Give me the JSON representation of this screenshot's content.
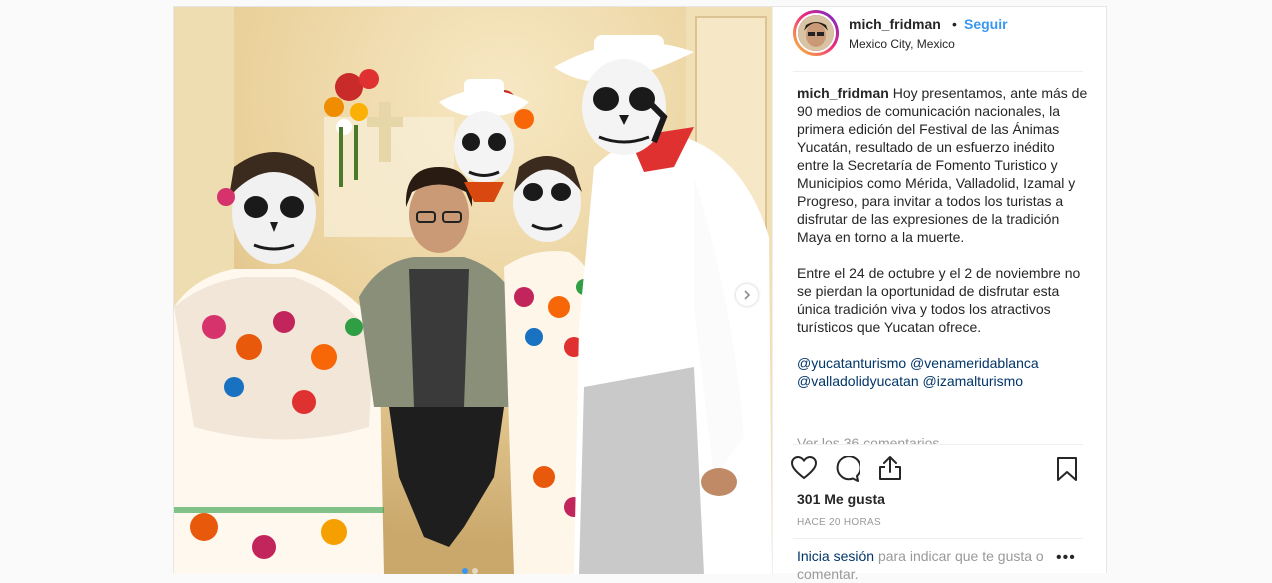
{
  "header": {
    "username": "mich_fridman",
    "separator": "•",
    "follow_label": "Seguir",
    "location": "Mexico City, Mexico"
  },
  "caption": {
    "username": "mich_fridman",
    "paragraph1": "Hoy presentamos, ante más de 90 medios de comunicación nacionales, la primera edición del Festival de las Ánimas Yucatán, resultado de un esfuerzo inédito entre la Secretaría de Fomento Turistico y Municipios como Mérida, Valladolid, Izamal y Progreso, para invitar a todos los turistas a disfrutar de las expresiones de la tradición Maya en torno a la muerte.",
    "paragraph2": "Entre el 24 de octubre y el 2 de noviembre no se pierdan la oportunidad de disfrutar esta única tradición viva y todos los atractivos turísticos que Yucatan ofrece.",
    "mentions": [
      "@yucatanturismo",
      "@venameridablanca",
      "@valladolidyucatan",
      "@izamalturismo"
    ]
  },
  "view_comments": "Ver los 36 comentarios",
  "actions": {
    "like_icon": "heart-icon",
    "comment_icon": "comment-icon",
    "share_icon": "share-icon",
    "save_icon": "bookmark-icon"
  },
  "likes": "301 Me gusta",
  "timestamp": "HACE 20 HORAS",
  "login": {
    "link": "Inicia sesión",
    "rest": "para indicar que te gusta o comentar.",
    "more": "•••"
  },
  "carousel": {
    "next_icon": "chevron-right-icon",
    "slide_count": 2,
    "active_slide": 1
  },
  "colors": {
    "accent": "#3897f0",
    "link": "#003569",
    "muted": "#999999"
  }
}
